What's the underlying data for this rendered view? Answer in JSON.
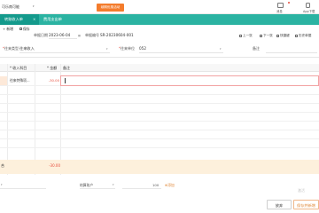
{
  "topbar": {
    "company": "可乐南可能",
    "trial_button": "续期优惠活动",
    "icons": [
      {
        "name": "message-icon",
        "label": "消息"
      },
      {
        "name": "app-download-icon",
        "label": "App下载"
      }
    ]
  },
  "tabs": [
    {
      "label": "转账收入单",
      "active": true,
      "close": "×"
    },
    {
      "label": "费用支出单",
      "active": false,
      "close": ""
    }
  ],
  "toolbar": {
    "new_label": "+ 新增",
    "save_label": "保存",
    "right": [
      {
        "icon": "prev-icon",
        "label": "上一张"
      },
      {
        "icon": "next-icon",
        "label": "下一张"
      },
      {
        "icon": "shortcut-icon",
        "label": "快捷键"
      },
      {
        "icon": "history-icon",
        "label": "历史单据"
      }
    ]
  },
  "form": {
    "date_label": "单据日期",
    "date_value": "2023-06-04",
    "number_label": "单据编号",
    "number_value": "SR-20230604-001",
    "type_label": "往来类型",
    "type_value": "往来收入",
    "unit_label": "往来单位",
    "unit_value": "052",
    "remark_label": "备注",
    "remark_value": ""
  },
  "grid": {
    "headers": {
      "account": "* 收入科目",
      "amount": "* 金额",
      "note": "备注"
    },
    "rows": [
      {
        "account": "往来特殊项...",
        "amount": "-30.00",
        "note": ""
      }
    ],
    "total_mark": "合",
    "total_amount": "-30.00"
  },
  "footer": {
    "account_placeholder": "",
    "settlement_label": "结算账户",
    "amount_value": "100",
    "add_link": "添加"
  },
  "actions": {
    "discard": "放弃",
    "save_and_new": "保存并新增"
  },
  "watermark": "激活"
}
